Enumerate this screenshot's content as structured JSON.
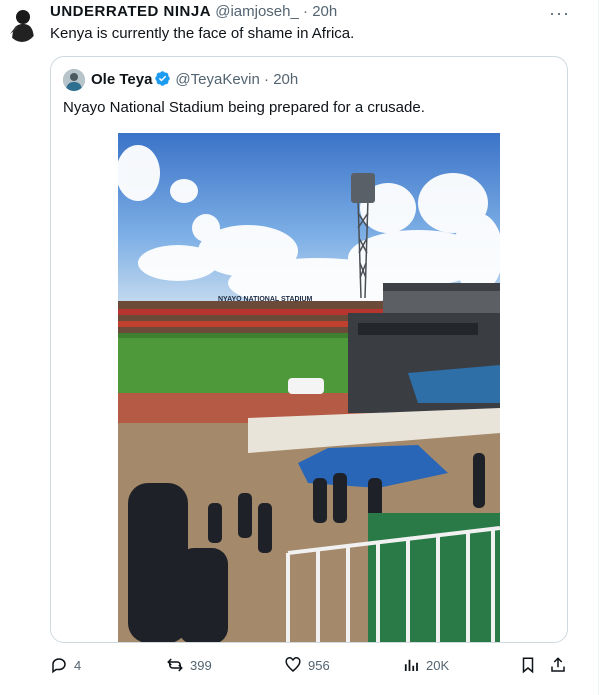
{
  "tweet": {
    "author_name": "UNDERRATED NINJA",
    "author_handle": "@iamjoseh_",
    "separator": "·",
    "time": "20h",
    "text": "Kenya is currently the face of shame in Africa.",
    "more_icon": "more-dots-icon"
  },
  "quote": {
    "author_name": "Ole Teya",
    "author_handle": "@TeyaKevin",
    "separator": "·",
    "time": "20h",
    "text": "Nyayo National Stadium being prepared for a crusade.",
    "verified_color": "#1d9bf0",
    "photo": {
      "stadium_sign": "NYAYO NATIONAL STADIUM"
    }
  },
  "actions": {
    "replies": "4",
    "retweets": "399",
    "likes": "956",
    "views": "20K"
  },
  "colors": {
    "text": "#0f1419",
    "muted": "#536471",
    "border": "#cfd9de"
  }
}
